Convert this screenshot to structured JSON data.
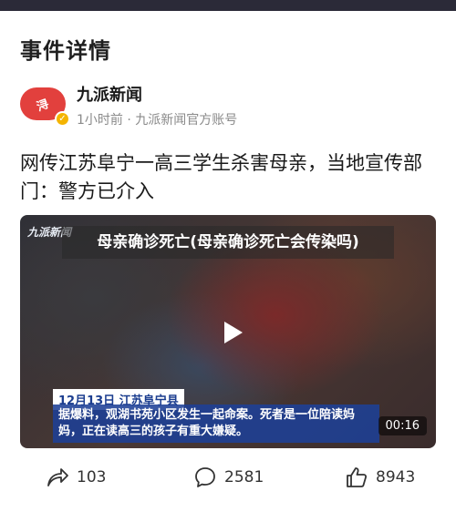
{
  "page": {
    "title": "事件详情"
  },
  "source": {
    "avatar_glyph": "浔",
    "name": "九派新闻",
    "meta": "1小时前 · 九派新闻官方账号",
    "verified_icon": "check-badge-icon"
  },
  "article": {
    "headline": "网传江苏阜宁一高三学生杀害母亲，当地宣传部门：警方已介入"
  },
  "video": {
    "logo": "九派新闻",
    "overlay_title": "母亲确诊死亡(母亲确诊死亡会传染吗)",
    "caption_date": "12月13日 江苏阜宁县",
    "caption_text": "据爆料，观湖书苑小区发生一起命案。死者是一位陪读妈妈，正在读高三的孩子有重大嫌疑。",
    "duration": "00:16",
    "play_icon": "play-icon"
  },
  "actions": {
    "share_count": "103",
    "comment_count": "2581",
    "like_count": "8943"
  },
  "colors": {
    "accent_avatar": "#e2403d",
    "verified": "#f4b400",
    "caption_blue": "#1e4096",
    "top_bar": "#2b2a38"
  }
}
